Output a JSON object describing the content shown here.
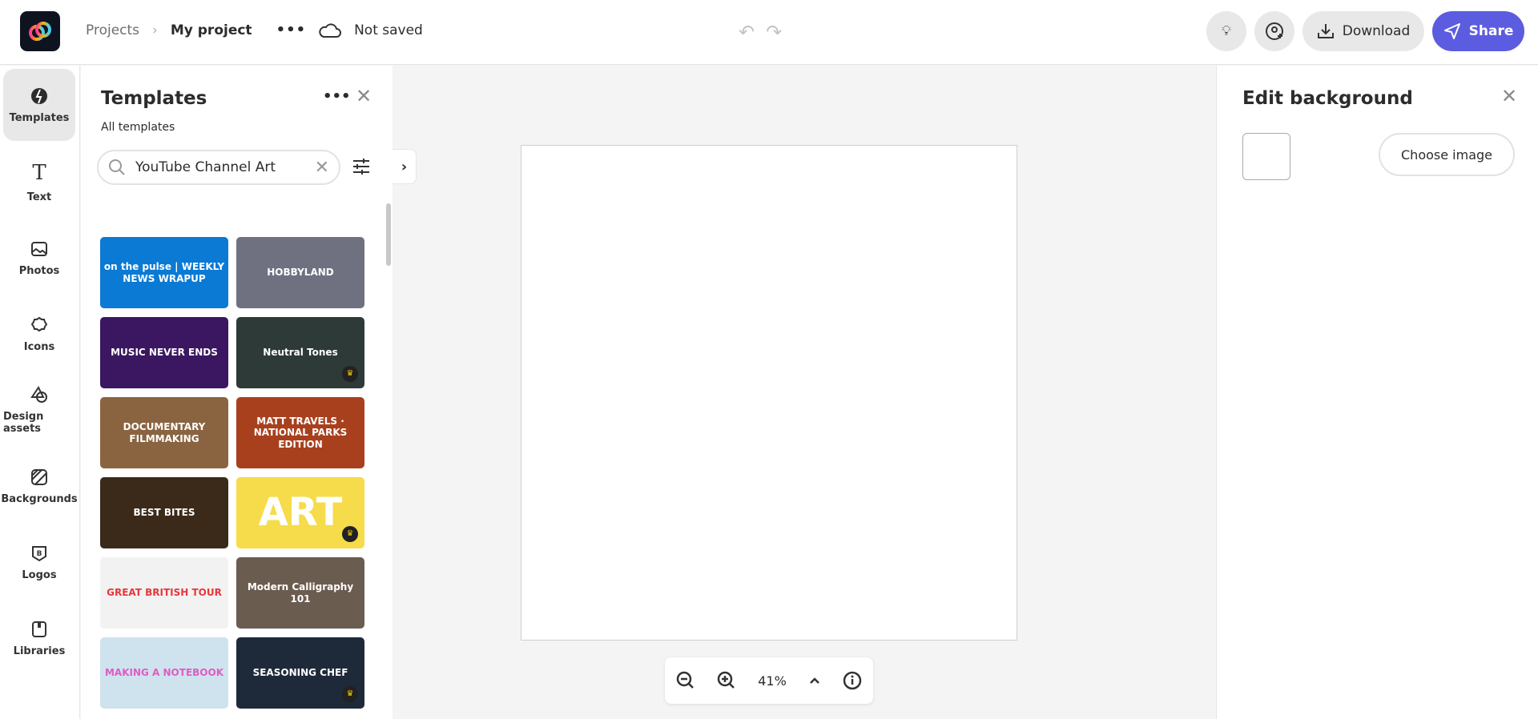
{
  "header": {
    "breadcrumb_root": "Projects",
    "project_name": "My project",
    "save_status": "Not saved",
    "download_label": "Download",
    "share_label": "Share",
    "accent": "#5c5ce0"
  },
  "rail": {
    "items": [
      {
        "label": "Templates",
        "icon": "templates-icon"
      },
      {
        "label": "Text",
        "icon": "text-icon"
      },
      {
        "label": "Photos",
        "icon": "photo-icon"
      },
      {
        "label": "Icons",
        "icon": "icons-icon"
      },
      {
        "label": "Design assets",
        "icon": "shapes-icon"
      },
      {
        "label": "Backgrounds",
        "icon": "background-icon"
      },
      {
        "label": "Logos",
        "icon": "logo-icon"
      },
      {
        "label": "Libraries",
        "icon": "library-icon"
      }
    ]
  },
  "panel": {
    "title": "Templates",
    "subtitle": "All templates",
    "search_value": "YouTube Channel Art",
    "templates": [
      {
        "text": "on the pulse | WEEKLY NEWS WRAPUP",
        "bg": "#0a7ad4"
      },
      {
        "text": "HOBBYLAND",
        "bg": "#6f7180"
      },
      {
        "text": "MUSIC NEVER ENDS",
        "bg": "#3a1760"
      },
      {
        "text": "Neutral Tones",
        "bg": "#2d3a38",
        "premium": true
      },
      {
        "text": "DOCUMENTARY FILMMAKING",
        "bg": "#8a6440"
      },
      {
        "text": "MATT TRAVELS · NATIONAL PARKS EDITION",
        "bg": "#a8401e"
      },
      {
        "text": "BEST BITES",
        "bg": "#3b2a1a"
      },
      {
        "text": "ART",
        "bg": "#f6dc4a",
        "premium": true
      },
      {
        "text": "GREAT BRITISH TOUR",
        "bg": "#f2f2f2"
      },
      {
        "text": "Modern Calligraphy 101",
        "bg": "#6b5c50"
      },
      {
        "text": "MAKING A NOTEBOOK",
        "bg": "#cfe3ee"
      },
      {
        "text": "SEASONING CHEF",
        "bg": "#1e2a3a",
        "premium": true
      }
    ]
  },
  "zoom": {
    "level": "41%"
  },
  "right": {
    "title": "Edit background",
    "choose_label": "Choose image"
  }
}
